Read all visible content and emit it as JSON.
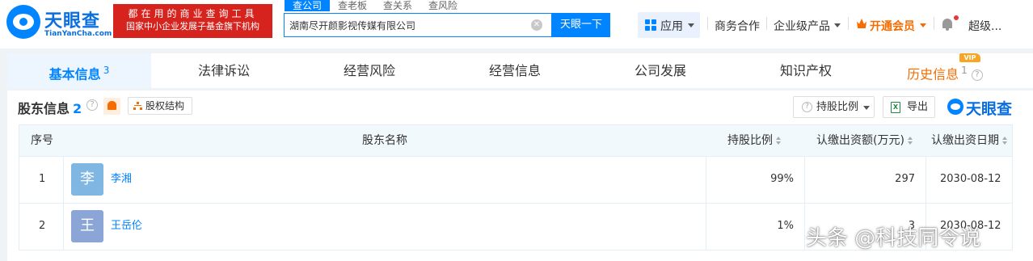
{
  "header": {
    "logo_cn": "天眼查",
    "logo_en": "TianYanCha.com",
    "slogan_line1": "都在用的商业查询工具",
    "slogan_line2": "国家中小企业发展子基金旗下机构",
    "search_tabs": [
      "查公司",
      "查老板",
      "查关系",
      "查风险"
    ],
    "search_value": "湖南尽开颜影视传媒有限公司",
    "search_button": "天眼一下",
    "nav_app": "应用",
    "nav_business": "商务合作",
    "nav_enterprise": "企业级产品",
    "nav_vip": "开通会员",
    "nav_user": "超级..."
  },
  "tabs": {
    "basic": "基本信息",
    "basic_count": "3",
    "legal": "法律诉讼",
    "risk": "经营风险",
    "operation": "经营信息",
    "development": "公司发展",
    "ip": "知识产权",
    "history": "历史信息",
    "history_count": "1",
    "vip_badge": "VIP"
  },
  "section": {
    "title": "股东信息",
    "count": "2",
    "equity_button": "股权结构",
    "ratio_button": "持股比例",
    "export_button": "导出",
    "brand": "天眼查"
  },
  "table": {
    "headers": {
      "index": "序号",
      "name": "股东名称",
      "ratio": "持股比例",
      "capital": "认缴出资额(万元)",
      "date": "认缴出资日期"
    },
    "rows": [
      {
        "index": "1",
        "avatar": "李",
        "name": "李湘",
        "ratio": "99%",
        "capital": "297",
        "date": "2030-08-12",
        "avatar_color": "#7fb6e2"
      },
      {
        "index": "2",
        "avatar": "王",
        "name": "王岳伦",
        "ratio": "1%",
        "capital": "3",
        "date": "2030-08-12",
        "avatar_color": "#8aa5d6"
      }
    ]
  },
  "watermark": "头条 @科技同令说",
  "colors": {
    "brand_blue": "#0084ff",
    "slogan_red": "#d6231d",
    "vip_orange": "#f66c00"
  }
}
